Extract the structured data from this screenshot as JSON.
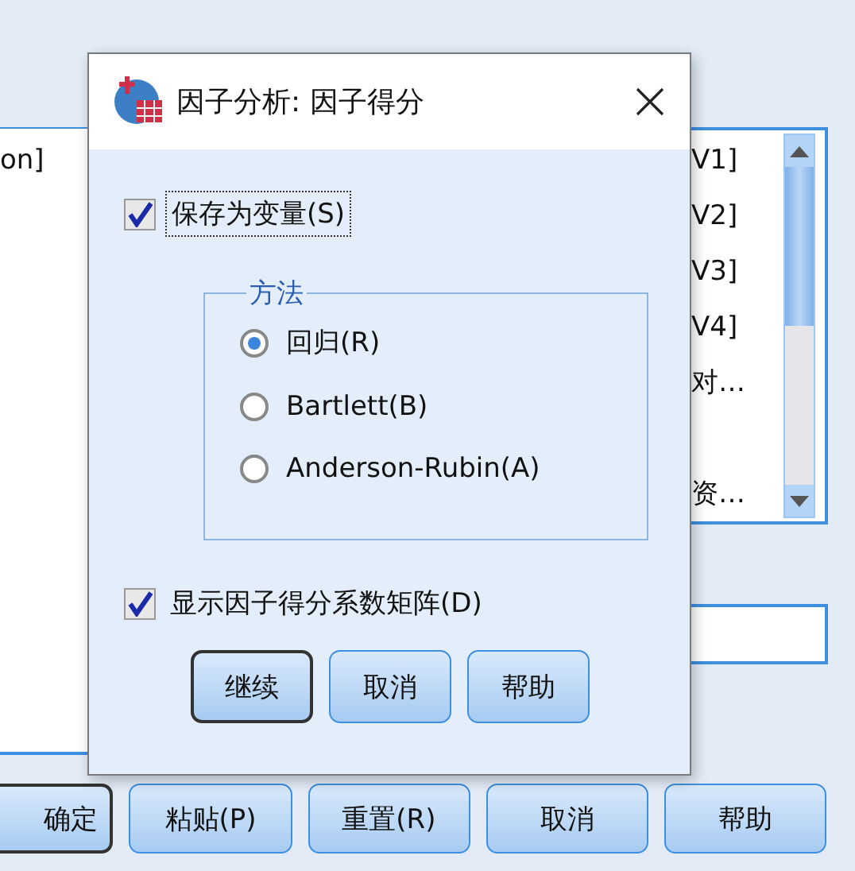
{
  "background_window": {
    "left_list": {
      "items": [
        "on]"
      ]
    },
    "right_list": {
      "items": [
        "V1]",
        "V2]",
        "V3]",
        "V4]",
        "对…",
        "资…"
      ]
    },
    "buttons": [
      {
        "label": "确定",
        "default": true
      },
      {
        "label": "粘贴(P)",
        "default": false
      },
      {
        "label": "重置(R)",
        "default": false
      },
      {
        "label": "取消",
        "default": false
      },
      {
        "label": "帮助",
        "default": false
      }
    ]
  },
  "dialog": {
    "title": "因子分析: 因子得分",
    "save_as_variables": {
      "label": "保存为变量(S)",
      "checked": true
    },
    "method": {
      "title": "方法",
      "options": [
        {
          "label": "回归(R)",
          "selected": true
        },
        {
          "label": "Bartlett(B)",
          "selected": false
        },
        {
          "label": "Anderson-Rubin(A)",
          "selected": false
        }
      ]
    },
    "display_matrix": {
      "label": "显示因子得分系数矩阵(D)",
      "checked": true
    },
    "buttons": [
      {
        "label": "继续",
        "default": true
      },
      {
        "label": "取消",
        "default": false
      },
      {
        "label": "帮助",
        "default": false
      }
    ]
  }
}
